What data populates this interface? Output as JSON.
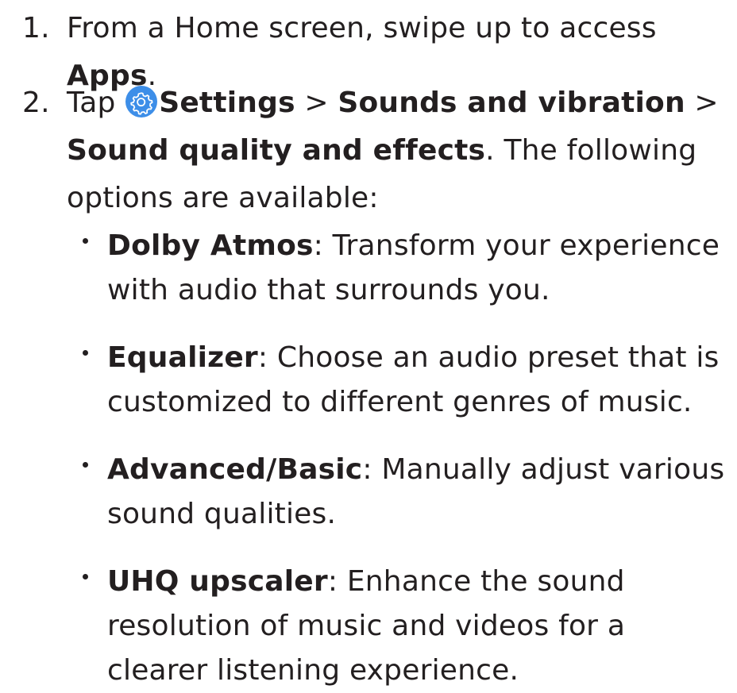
{
  "steps": [
    {
      "number": "1.",
      "parts": [
        {
          "text": "From a Home screen, swipe up to access ",
          "bold": false
        },
        {
          "text": "Apps",
          "bold": true
        },
        {
          "text": ".",
          "bold": false
        }
      ]
    },
    {
      "number": "2.",
      "parts_before_icon": [
        {
          "text": "Tap ",
          "bold": false
        }
      ],
      "icon": "settings-gear-icon",
      "parts_after_icon": [
        {
          "text": "Settings",
          "bold": true
        },
        {
          "text": " > ",
          "bold": false
        },
        {
          "text": "Sounds and vibration",
          "bold": true
        },
        {
          "text": " > ",
          "bold": false
        },
        {
          "text": "Sound quality and effects",
          "bold": true
        },
        {
          "text": ". The following options are available:",
          "bold": false
        }
      ]
    }
  ],
  "options": [
    {
      "term": "Dolby Atmos",
      "description": ": Transform your experience with audio that surrounds you."
    },
    {
      "term": "Equalizer",
      "description": ": Choose an audio preset that is customized to different genres of music."
    },
    {
      "term": "Advanced/Basic",
      "description": ": Manually adjust various sound qualities."
    },
    {
      "term": "UHQ upscaler",
      "description": ": Enhance the sound resolution of music and videos for a clearer listening experience."
    }
  ],
  "colors": {
    "text": "#231f20",
    "icon_background": "#3d8ee8"
  }
}
